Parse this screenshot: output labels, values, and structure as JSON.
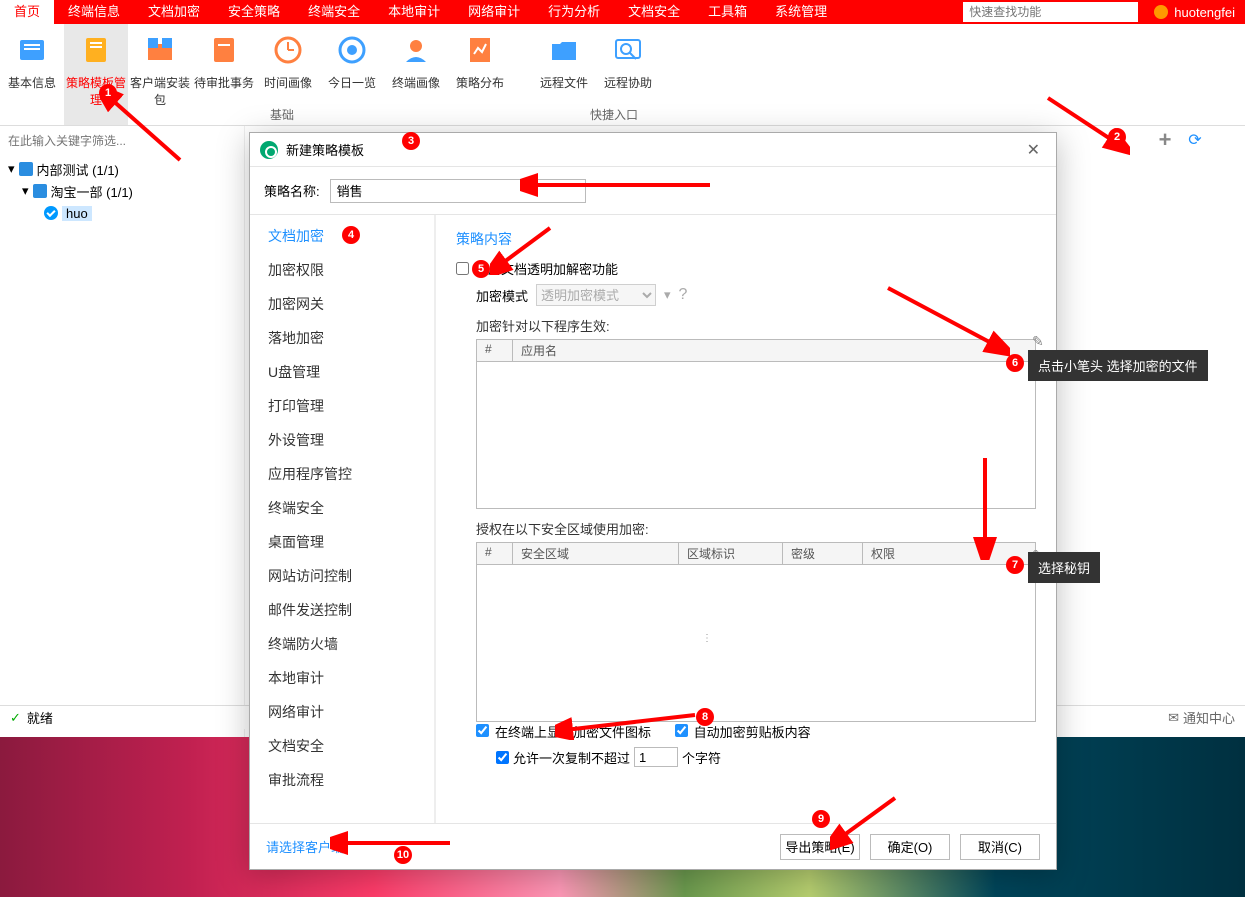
{
  "topbar": {
    "tabs": [
      "首页",
      "终端信息",
      "文档加密",
      "安全策略",
      "终端安全",
      "本地审计",
      "网络审计",
      "行为分析",
      "文档安全",
      "工具箱",
      "系统管理"
    ],
    "search_placeholder": "快速查找功能",
    "username": "huotengfei"
  },
  "ribbon": {
    "items": [
      {
        "label": "基本信息"
      },
      {
        "label": "策略模板管理"
      },
      {
        "label": "客户端安装包"
      },
      {
        "label": "待审批事务"
      },
      {
        "label": "时间画像"
      },
      {
        "label": "今日一览"
      },
      {
        "label": "终端画像"
      },
      {
        "label": "策略分布"
      },
      {
        "label": "远程文件"
      },
      {
        "label": "远程协助"
      }
    ],
    "group1": "基础",
    "group2": "快捷入口"
  },
  "sidebar": {
    "filter_placeholder": "在此输入关键字筛选...",
    "tree": [
      {
        "label": "内部测试 (1/1)"
      },
      {
        "label": "淘宝一部 (1/1)"
      },
      {
        "label": "huo"
      }
    ]
  },
  "statusbar": {
    "ready": "就绪",
    "notice": "通知中心"
  },
  "modal": {
    "title": "新建策略模板",
    "name_label": "策略名称:",
    "name_value": "销售",
    "categories": [
      "文档加密",
      "加密权限",
      "加密网关",
      "落地加密",
      "U盘管理",
      "打印管理",
      "外设管理",
      "应用程序管控",
      "终端安全",
      "桌面管理",
      "网站访问控制",
      "邮件发送控制",
      "终端防火墙",
      "本地审计",
      "网络审计",
      "文档安全",
      "审批流程"
    ],
    "panel": {
      "title": "策略内容",
      "chk_enable": "启用文档透明加解密功能",
      "mode_label": "加密模式",
      "mode_value": "透明加密模式",
      "target_label": "加密针对以下程序生效:",
      "col_num": "#",
      "col_app": "应用名",
      "zone_label": "授权在以下安全区域使用加密:",
      "zcol_num": "#",
      "zcol_zone": "安全区域",
      "zcol_mark": "区域标识",
      "zcol_level": "密级",
      "zcol_perm": "权限",
      "chk_icon": "在终端上显示加密文件图标",
      "chk_clip": "自动加密剪贴板内容",
      "chk_copy": "允许一次复制不超过",
      "chk_copy_val": "1",
      "chk_copy_suffix": "个字符"
    },
    "footer": {
      "link": "请选择客户端",
      "export": "导出策略(E)",
      "ok": "确定(O)",
      "cancel": "取消(C)"
    }
  },
  "annotations": {
    "tip6": "点击小笔头 选择加密的文件",
    "tip7": "选择秘钥"
  }
}
